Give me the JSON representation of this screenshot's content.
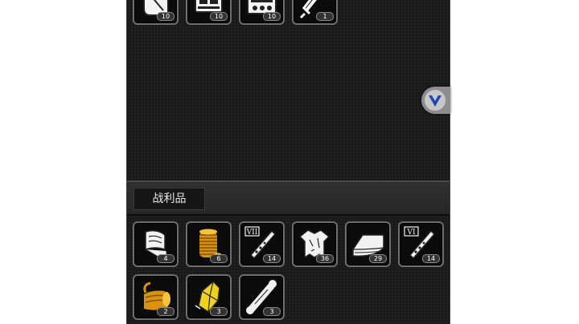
{
  "inventory_top": {
    "items": [
      {
        "icon": "scroll-icon",
        "qty": "10"
      },
      {
        "icon": "device-icon",
        "qty": "10"
      },
      {
        "icon": "machine-icon",
        "qty": "10"
      },
      {
        "icon": "sword-icon",
        "qty": "1"
      }
    ]
  },
  "loot": {
    "title": "战利品",
    "items": [
      {
        "icon": "scroll-icon",
        "qty": "4"
      },
      {
        "icon": "coin-stack-icon",
        "qty": "6"
      },
      {
        "icon": "potion-vial-vii-icon",
        "qty": "14"
      },
      {
        "icon": "tattered-cloth-icon",
        "qty": "36"
      },
      {
        "icon": "cloth-bolt-icon",
        "qty": "29"
      },
      {
        "icon": "potion-vial-vi-icon",
        "qty": "14"
      },
      {
        "icon": "gold-scroll-icon",
        "qty": "2"
      },
      {
        "icon": "gold-crystal-icon",
        "qty": "3"
      },
      {
        "icon": "bone-icon",
        "qty": "3"
      }
    ]
  },
  "colors": {
    "panel_bg": "#1a1a1a",
    "slot_border": "#6e6e6e",
    "gold": "#e0a20e",
    "float_button": "#8d8d8d",
    "float_icon": "#1f46b4"
  }
}
